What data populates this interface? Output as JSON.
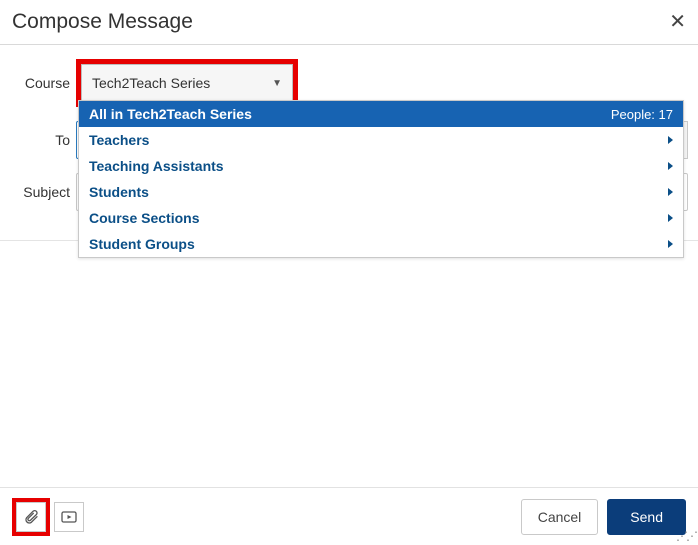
{
  "header": {
    "title": "Compose Message"
  },
  "labels": {
    "course": "Course",
    "to": "To",
    "subject": "Subject"
  },
  "course": {
    "selected": "Tech2Teach Series"
  },
  "to": {
    "value": ""
  },
  "subject": {
    "value": ""
  },
  "dropdown": {
    "allLabel": "All in Tech2Teach Series",
    "peopleCountLabel": "People: 17",
    "items": [
      {
        "label": "Teachers",
        "hasSubmenu": true
      },
      {
        "label": "Teaching Assistants",
        "hasSubmenu": true
      },
      {
        "label": "Students",
        "hasSubmenu": true
      },
      {
        "label": "Course Sections",
        "hasSubmenu": true
      },
      {
        "label": "Student Groups",
        "hasSubmenu": true
      }
    ]
  },
  "footer": {
    "cancel": "Cancel",
    "send": "Send"
  },
  "icons": {
    "close": "✕"
  }
}
